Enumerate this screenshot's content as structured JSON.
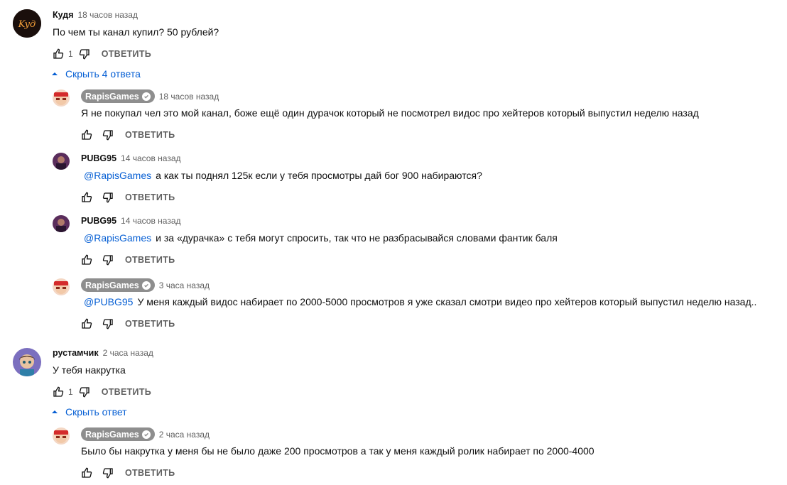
{
  "reply_label": "ОТВЕТИТЬ",
  "comments": [
    {
      "author": "Кудя",
      "time": "18 часов назад",
      "text": "По чем ты канал купил? 50 рублей?",
      "likes": "1",
      "avatar_text": "Kyд"
    },
    {
      "author": "рустамчик",
      "time": "2 часа назад",
      "text": "У тебя накрутка",
      "likes": "1"
    }
  ],
  "toggles": [
    "Скрыть 4 ответа",
    "Скрыть ответ"
  ],
  "replies": [
    {
      "author": "RapisGames",
      "time": "18 часов назад",
      "mention": "",
      "text": "Я не покупал чел это мой канал, боже ещё один дурачок который не посмотрел видос про хейтеров который выпустил неделю назад"
    },
    {
      "author": "PUBG95",
      "time": "14 часов назад",
      "mention": "@RapisGames",
      "text": "а как ты поднял 125к если у тебя просмотры дай бог 900 набираются?"
    },
    {
      "author": "PUBG95",
      "time": "14 часов назад",
      "mention": "@RapisGames",
      "text": "и за «дурачка» с тебя могут спросить, так что не разбрасывайся словами фантик баля"
    },
    {
      "author": "RapisGames",
      "time": "3 часа назад",
      "mention": "@PUBG95",
      "text": "У меня каждый видос набирает по 2000-5000 просмотров я уже сказал смотри видео про хейтеров который выпустил неделю назад.."
    },
    {
      "author": "RapisGames",
      "time": "2 часа назад",
      "mention": "",
      "text": "Было бы накрутка у меня бы не было даже 200 просмотров а так у меня каждый ролик набирает по 2000-4000"
    }
  ],
  "colors": {
    "link": "#065fd4",
    "meta": "#606060",
    "owner_chip": "#8e8e8e"
  }
}
